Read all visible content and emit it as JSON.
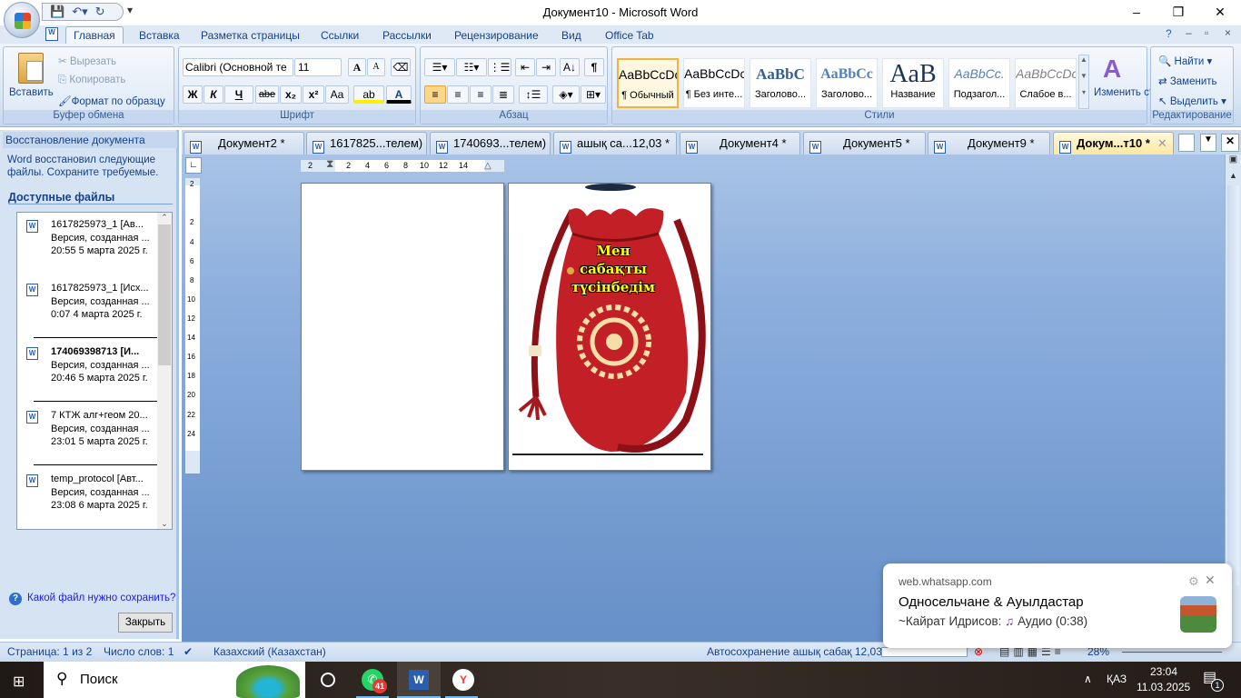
{
  "window": {
    "title": "Документ10 - Microsoft Word",
    "minimize": "–",
    "maximize": "❐",
    "close": "✕"
  },
  "ribbon_tabs": [
    "Главная",
    "Вставка",
    "Разметка страницы",
    "Ссылки",
    "Рассылки",
    "Рецензирование",
    "Вид",
    "Office Tab"
  ],
  "clipboard": {
    "paste": "Вставить",
    "cut": "Вырезать",
    "copy": "Копировать",
    "format_painter": "Формат по образцу",
    "label": "Буфер обмена"
  },
  "font": {
    "name": "Calibri (Основной те",
    "size": "11",
    "bold": "Ж",
    "italic": "К",
    "underline": "Ч",
    "strike": "abe",
    "sub": "x₂",
    "sup": "x²",
    "case": "Aa",
    "grow": "A",
    "shrink": "A",
    "label": "Шрифт"
  },
  "paragraph": {
    "label": "Абзац",
    "pilcrow": "¶"
  },
  "styles": {
    "label": "Стили",
    "items": [
      {
        "preview": "AaBbCcDc",
        "name": "¶ Обычный"
      },
      {
        "preview": "AaBbCcDc",
        "name": "¶ Без инте..."
      },
      {
        "preview": "AaBbC",
        "name": "Заголово..."
      },
      {
        "preview": "AaBbCc",
        "name": "Заголово..."
      },
      {
        "preview": "AaB",
        "name": "Название"
      },
      {
        "preview": "AaBbCc.",
        "name": "Подзагол..."
      },
      {
        "preview": "AaBbCcDc",
        "name": "Слабое в..."
      }
    ],
    "change": "Изменить стили"
  },
  "editing": {
    "find": "Найти",
    "replace": "Заменить",
    "select": "Выделить",
    "label": "Редактирование"
  },
  "recovery": {
    "title": "Восстановление документа",
    "message": "Word восстановил следующие файлы.  Сохраните требуемые.",
    "available": "Доступные файлы",
    "files": [
      {
        "name": "1617825973_1  [Ав...",
        "version": "Версия, созданная ...",
        "time": "20:55 5 марта 2025 г."
      },
      {
        "name": "1617825973_1  [Исх...",
        "version": "Версия, созданная ...",
        "time": "0:07 4 марта 2025 г."
      },
      {
        "name": "174069398713  [И...",
        "version": "Версия, созданная ...",
        "time": "20:46 5 марта 2025 г."
      },
      {
        "name": "7 КТЖ алг+геом 20...",
        "version": "Версия, созданная ...",
        "time": "23:01 5 марта 2025 г."
      },
      {
        "name": "temp_protocol  [Авт...",
        "version": "Версия, созданная ...",
        "time": "23:08 6 марта 2025 г."
      }
    ],
    "help": "Какой файл нужно сохранить?",
    "close": "Закрыть"
  },
  "doc_tabs": [
    "Документ2 *",
    "1617825...телем)",
    "1740693...телем)",
    "ашық са...12,03 *",
    "Документ4 *",
    "Документ5 *",
    "Документ9 *",
    "Докум...т10 *"
  ],
  "ruler": {
    "h": [
      "2",
      "2",
      "4",
      "6",
      "8",
      "10",
      "12",
      "14"
    ],
    "v": [
      "2",
      "2",
      "4",
      "6",
      "8",
      "10",
      "12",
      "14",
      "16",
      "18",
      "20",
      "22",
      "24"
    ]
  },
  "document": {
    "bag_text": [
      "Мен",
      "сабақты",
      "түсінбедім"
    ]
  },
  "status": {
    "page": "Страница: 1 из 2",
    "words": "Число слов: 1",
    "language": "Казахский (Казахстан)",
    "autosave": "Автосохранение ашық сабақ 12,03:",
    "zoom": "28%"
  },
  "taskbar": {
    "search": "Поиск",
    "whatsapp_badge": "41",
    "lang": "ҚАЗ",
    "time": "23:04",
    "date": "11.03.2025",
    "notif_count": "1"
  },
  "notification": {
    "source": "web.whatsapp.com",
    "title": "Односельчане & Ауылдастар",
    "body": "~Кайрат Идрисов:",
    "audio": "Аудио (0:38)"
  }
}
